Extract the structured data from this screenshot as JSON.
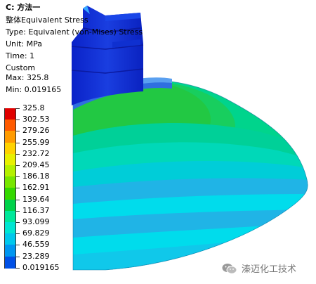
{
  "result": {
    "title": "C: 方法一",
    "line2": "整体Equivalent Stress",
    "type": "Type: Equivalent (von-Mises) Stress",
    "unit": "Unit: MPa",
    "time": "Time: 1",
    "custom": "Custom",
    "max": "Max: 325.8",
    "min": "Min: 0.019165"
  },
  "legend": {
    "labels": [
      "325.8",
      "302.53",
      "279.26",
      "255.99",
      "232.72",
      "209.45",
      "186.18",
      "162.91",
      "139.64",
      "116.37",
      "93.099",
      "69.829",
      "46.559",
      "23.289",
      "0.019165"
    ],
    "colors": [
      "#e00000",
      "#ff5a00",
      "#ff9b00",
      "#ffd200",
      "#e8f000",
      "#b4f000",
      "#78e600",
      "#34d800",
      "#00d24a",
      "#00e89a",
      "#00e6d2",
      "#00c8ec",
      "#0096f0",
      "#0050e6",
      "#0000dc"
    ]
  },
  "watermark": {
    "text": "溱迈化工技术",
    "icon": "wechat-icon"
  }
}
